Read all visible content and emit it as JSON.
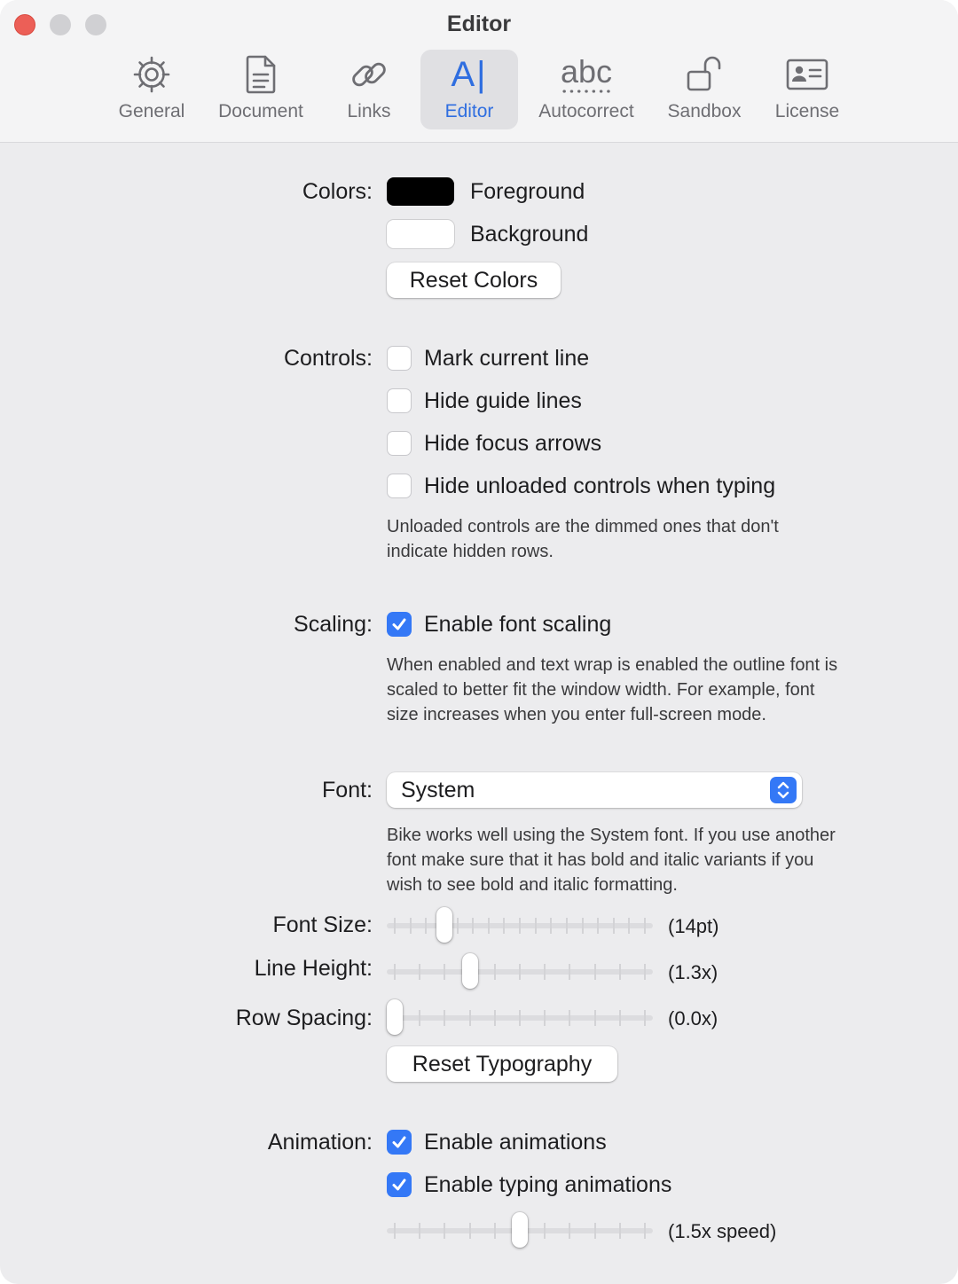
{
  "window": {
    "title": "Editor"
  },
  "toolbar": {
    "tabs": [
      {
        "label": "General",
        "icon": "gear-icon"
      },
      {
        "label": "Document",
        "icon": "document-icon"
      },
      {
        "label": "Links",
        "icon": "link-icon"
      },
      {
        "label": "Editor",
        "icon": "text-cursor-icon",
        "glyph": "A|",
        "selected": true
      },
      {
        "label": "Autocorrect",
        "icon": "abc-icon",
        "glyph": "abc"
      },
      {
        "label": "Sandbox",
        "icon": "unlocked-padlock-icon"
      },
      {
        "label": "License",
        "icon": "id-card-icon"
      }
    ]
  },
  "colors": {
    "label": "Colors:",
    "foreground_label": "Foreground",
    "background_label": "Background",
    "foreground_color": "#000000",
    "background_color": "#ffffff",
    "reset_label": "Reset Colors"
  },
  "controls": {
    "label": "Controls:",
    "options": [
      {
        "label": "Mark current line",
        "checked": false
      },
      {
        "label": "Hide guide lines",
        "checked": false
      },
      {
        "label": "Hide focus arrows",
        "checked": false
      },
      {
        "label": "Hide unloaded controls when typing",
        "checked": false
      }
    ],
    "note_line1": "Unloaded controls are the dimmed ones that don't",
    "note_line2": "indicate hidden rows."
  },
  "scaling": {
    "label": "Scaling:",
    "option_label": "Enable font scaling",
    "checked": true,
    "note_line1": "When enabled and text wrap is enabled the outline font is",
    "note_line2": "scaled to better fit the window width. For example, font",
    "note_line3": "size increases when you enter full-screen mode."
  },
  "font": {
    "label": "Font:",
    "selected": "System",
    "note_line1": "Bike works well using the System font. If you use another",
    "note_line2": "font make sure that it has bold and italic variants if you",
    "note_line3": "wish to see bold and italic formatting."
  },
  "typography": {
    "font_size": {
      "label": "Font Size:",
      "value": "14pt",
      "position": 0.2
    },
    "line_height": {
      "label": "Line Height:",
      "value": "1.3x",
      "position": 0.3
    },
    "row_spacing": {
      "label": "Row Spacing:",
      "value": "0.0x",
      "position": 0.0
    },
    "reset_label": "Reset Typography"
  },
  "animation": {
    "label": "Animation:",
    "enable_label": "Enable animations",
    "enable_checked": true,
    "typing_label": "Enable typing animations",
    "typing_checked": true,
    "speed": {
      "value": "1.5x speed",
      "position": 0.5
    }
  },
  "accent_color": "#3478f6"
}
